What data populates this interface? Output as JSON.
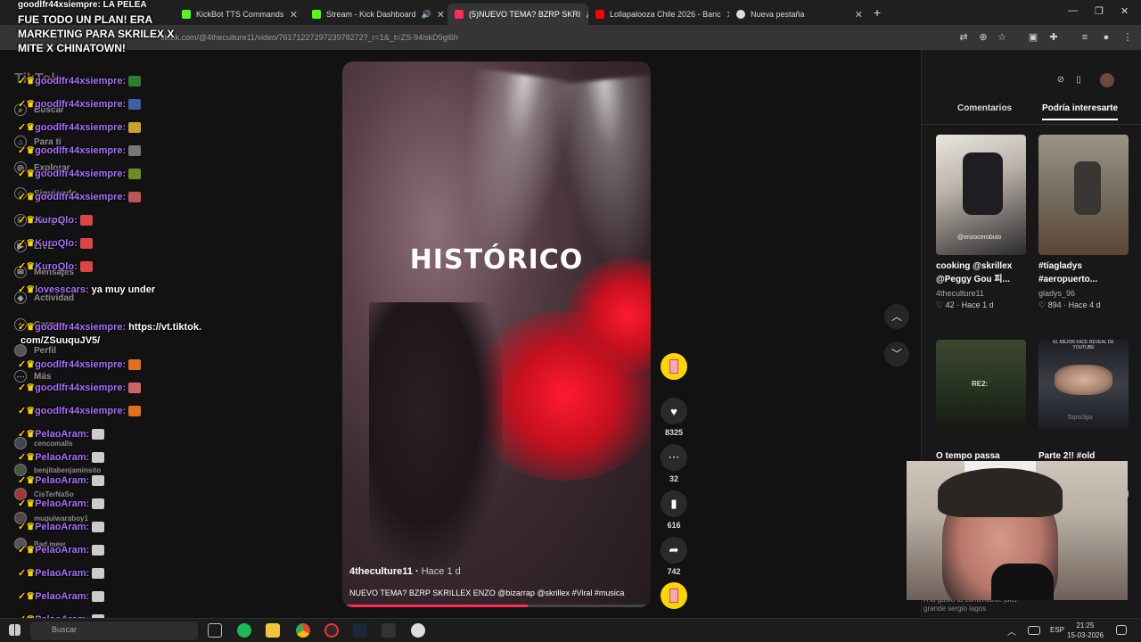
{
  "browser": {
    "tabs": [
      {
        "label": "KickBot TTS Commands",
        "color": "#53fc18"
      },
      {
        "label": "Stream - Kick Dashboard",
        "color": "#53fc18"
      },
      {
        "label": "(5)NUEVO TEMA? BZRP SKRI",
        "color": "#fe2c55"
      },
      {
        "label": "Lollapalooza Chile 2026 - Banc",
        "color": "#ff0000"
      },
      {
        "label": "Nueva pestaña",
        "color": "#dddddd"
      }
    ],
    "url": "tiktok.com/@4theculture11/video/7617122729723978272?_r=1&_t=ZS-94iskD9gl6h"
  },
  "tiktok": {
    "logo": "TikTok",
    "nav": [
      "Buscar",
      "Para ti",
      "Explorar",
      "Siguiendo",
      "Amigos",
      "LIVE",
      "Mensajes",
      "Actividad",
      "Cargar",
      "Perfil",
      "Más"
    ],
    "following": [
      "cencomalls",
      "benjitabenjaminsito",
      "CisTerNaSo",
      "muguiwaraboy1",
      "Bad mew"
    ],
    "video": {
      "overlay_text": "HISTÓRICO",
      "author": "4theculture11",
      "age": "Hace 1 d",
      "caption": "NUEVO TEMA? BZRP SKRILLEX ENZO @bizarrap @skrillex #Viral #musica",
      "progress": 0.6
    },
    "actions": {
      "likes": "8325",
      "comments": "32",
      "saves": "616",
      "shares": "742"
    },
    "right_panel": {
      "tab_comments": "Comentarios",
      "tab_interest": "Podría interesarte",
      "cards": [
        {
          "title": "cooking @skrillex @Peggy Gou 피...",
          "user": "4theculture11",
          "likes": "42",
          "age": "Hace 1 d",
          "thumb_label": "@enzocerobuto"
        },
        {
          "title": "#tíagladys #aeropuerto...",
          "user": "gladys_96",
          "likes": "894",
          "age": "Hace 4 d",
          "thumb_label": ""
        },
        {
          "title": "O tempo passa",
          "user": "",
          "likes": "",
          "age": "",
          "thumb_label": "RE2:"
        },
        {
          "title": "Parte 2!! #old",
          "user": "",
          "likes": "",
          "age": "5 d",
          "thumb_label": "EL MEJOR FACE REVEAL DE YOUTUBE"
        }
      ],
      "thumb2_sub": "Topsclips",
      "comment_snippet": "A la gusto tu comentario. jdks grande sergio lagos"
    }
  },
  "stream_chat": {
    "headline": "FUE TODO UN PLAN! ERA MARKETING PARA SKRILEX X MITE X CHINATOWN!",
    "headline_top": "goodlfr44xsiempre: LA PELEA",
    "lines": [
      {
        "user": "goodlfr44xsiempre:",
        "text": ""
      },
      {
        "user": "goodlfr44xsiempre:",
        "text": ""
      },
      {
        "user": "goodlfr44xsiempre:",
        "text": ""
      },
      {
        "user": "goodlfr44xsiempre:",
        "text": ""
      },
      {
        "user": "goodlfr44xsiempre:",
        "text": ""
      },
      {
        "user": "goodlfr44xsiempre:",
        "text": ""
      },
      {
        "user": "KuroQlo:",
        "text": ""
      },
      {
        "user": "KuroQlo:",
        "text": ""
      },
      {
        "user": "KuroQlo:",
        "text": ""
      },
      {
        "user": "lovesscars:",
        "text": "ya muy under"
      },
      {
        "user": "goodlfr44xsiempre:",
        "text": "https://vt.tiktok."
      },
      {
        "user": "",
        "text": "com/ZSuuquJV5/"
      },
      {
        "user": "goodlfr44xsiempre:",
        "text": ""
      },
      {
        "user": "goodlfr44xsiempre:",
        "text": ""
      },
      {
        "user": "goodlfr44xsiempre:",
        "text": ""
      },
      {
        "user": "PelaoAram:",
        "text": ""
      },
      {
        "user": "PelaoAram:",
        "text": ""
      },
      {
        "user": "PelaoAram:",
        "text": ""
      },
      {
        "user": "PelaoAram:",
        "text": ""
      },
      {
        "user": "PelaoAram:",
        "text": ""
      },
      {
        "user": "PelaoAram:",
        "text": ""
      },
      {
        "user": "PelaoAram:",
        "text": ""
      },
      {
        "user": "PelaoAram:",
        "text": ""
      },
      {
        "user": "PelaoAram:",
        "text": ""
      }
    ]
  },
  "taskbar": {
    "search": "Buscar",
    "lang": "ESP",
    "time": "21:25",
    "date": "15-03-2026"
  }
}
